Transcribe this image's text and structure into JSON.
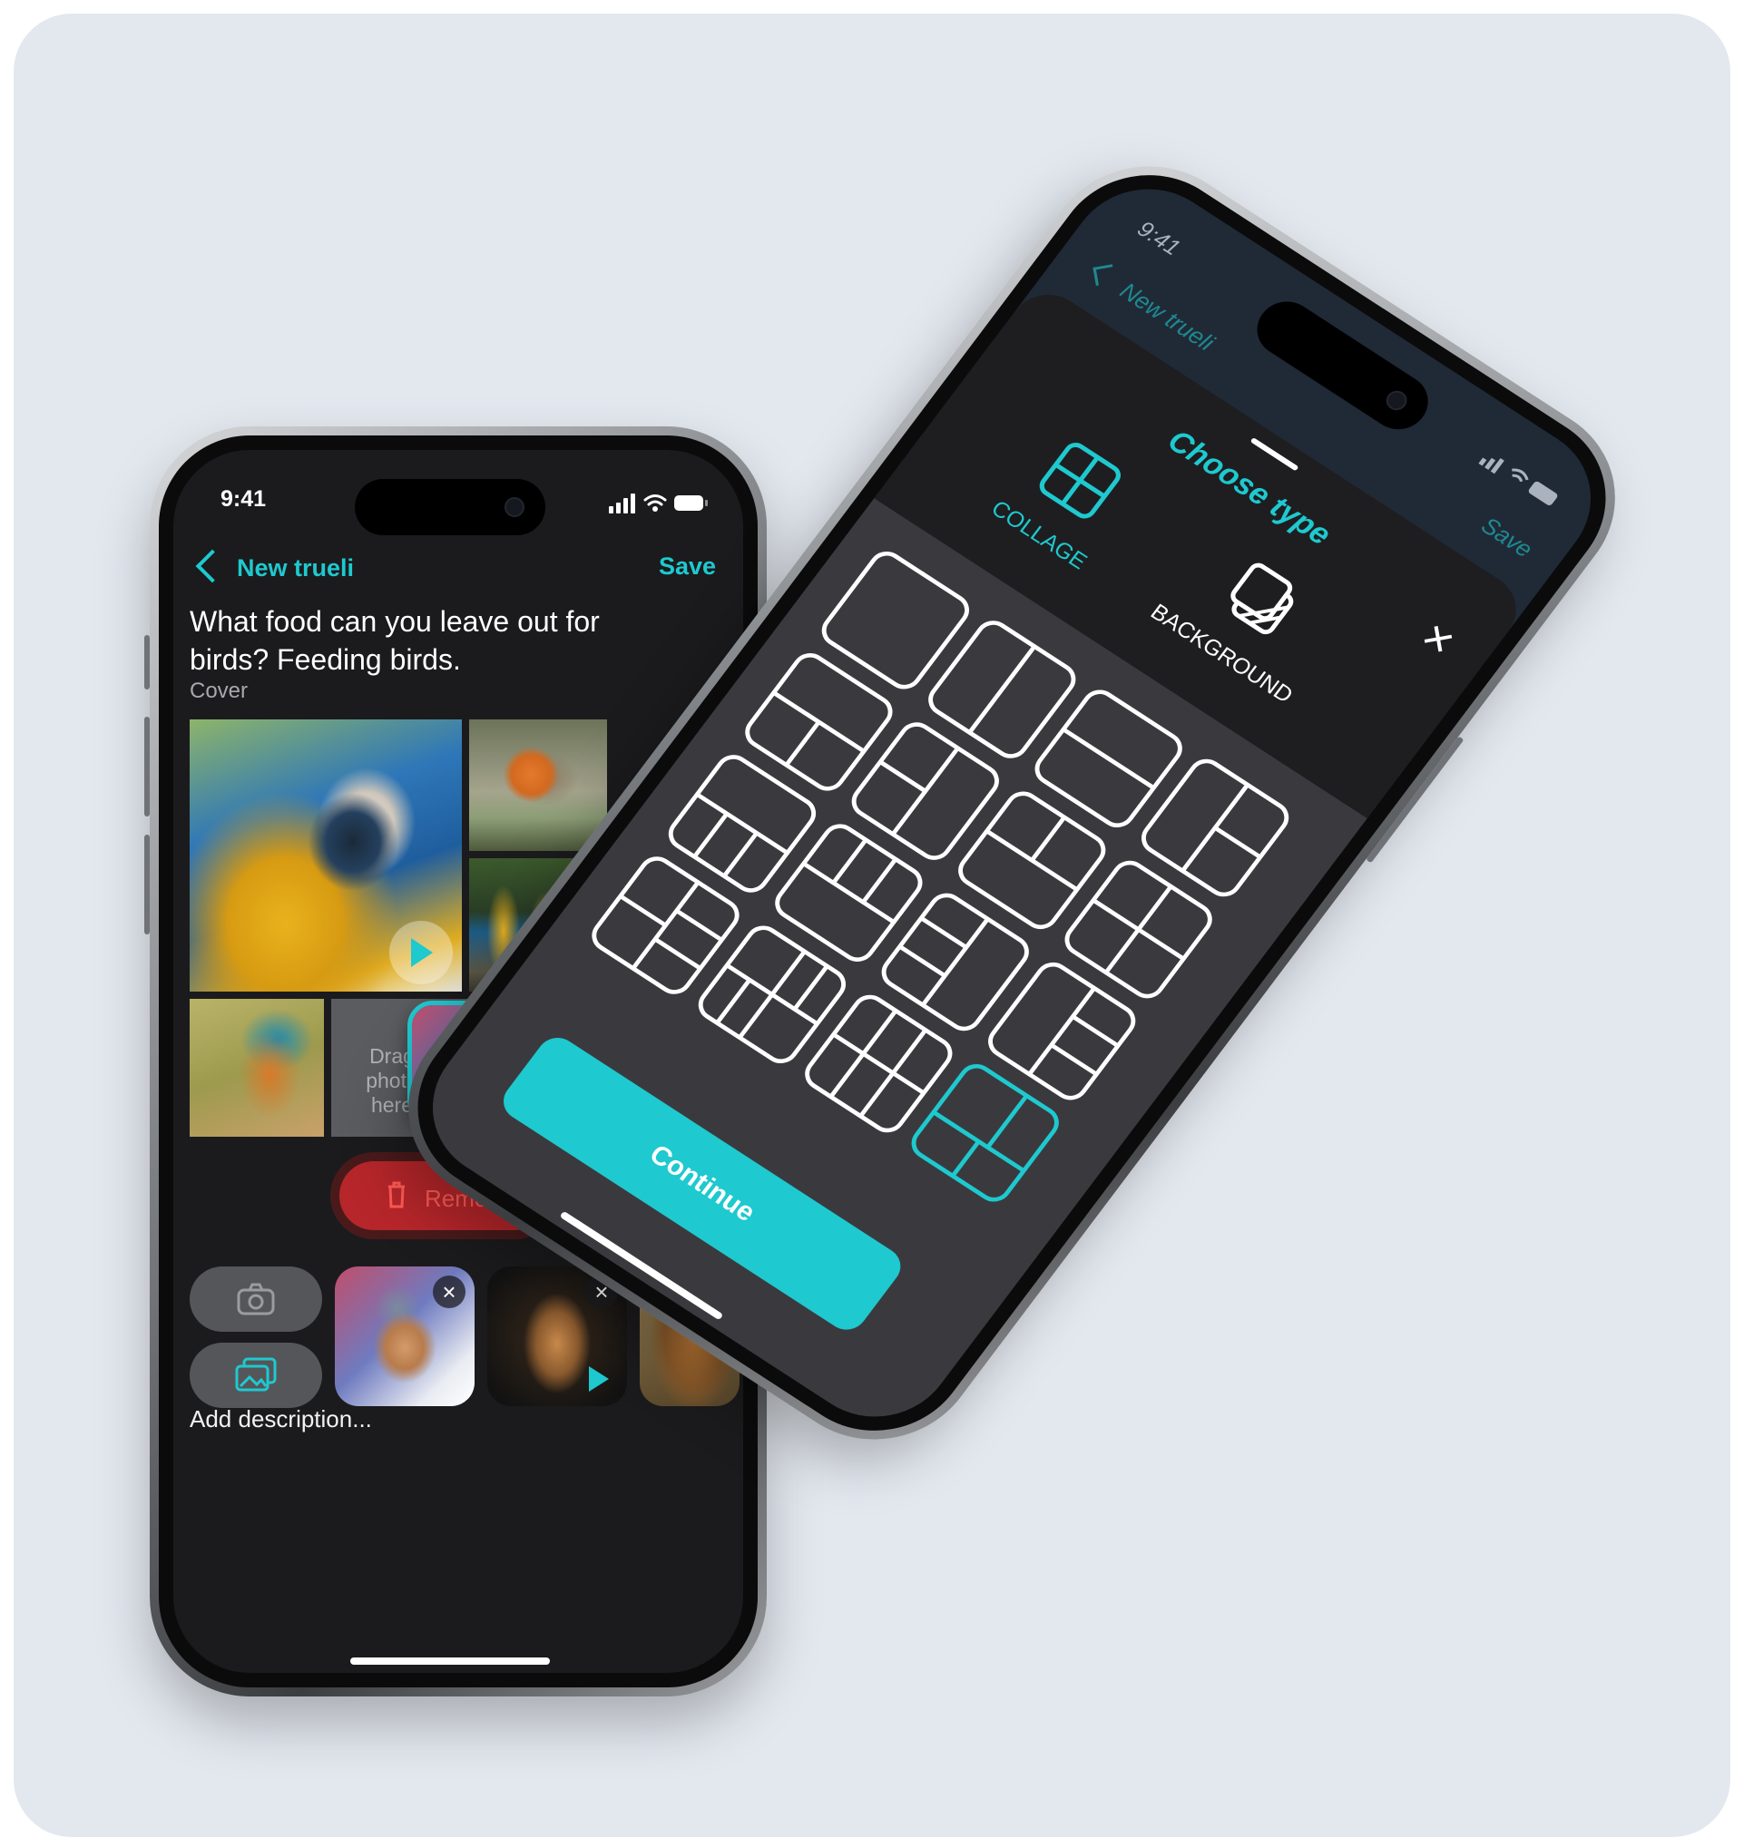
{
  "colors": {
    "accent": "#1ec9cf",
    "remove_red": "#b7262a",
    "background": "#e3e8ef"
  },
  "left_phone": {
    "status": {
      "time": "9:41"
    },
    "nav": {
      "back_icon": "chevron-left-icon",
      "title": "New trueli",
      "save_label": "Save"
    },
    "question": "What food can you leave out for birds? Feeding birds.",
    "cover_label": "Cover",
    "collage": {
      "drop_zone_text": "Drag photo here",
      "photos": [
        "macaw-photo",
        "robin-photo",
        "parrots-photo",
        "kingfisher-photo",
        "chaffinch-photo"
      ]
    },
    "remove_label": "Remove",
    "tray": {
      "camera_icon": "camera-icon",
      "gallery_icon": "gallery-icon",
      "thumbnails": [
        "chaffinch-thumb",
        "giraffe-thumb",
        "tiger-thumb"
      ]
    },
    "description_placeholder": "Add description..."
  },
  "right_phone": {
    "status": {
      "time": "9:41"
    },
    "nav": {
      "title": "New trueli",
      "save_label": "Save"
    },
    "sheet": {
      "title": "Choose type",
      "options": [
        {
          "label": "COLLAGE",
          "icon": "collage-icon",
          "selected": true
        },
        {
          "label": "BACKGROUND",
          "icon": "background-icon",
          "selected": false
        }
      ],
      "layouts_count_label": "",
      "selected_layout_index": 15,
      "continue_label": "Continue"
    }
  }
}
